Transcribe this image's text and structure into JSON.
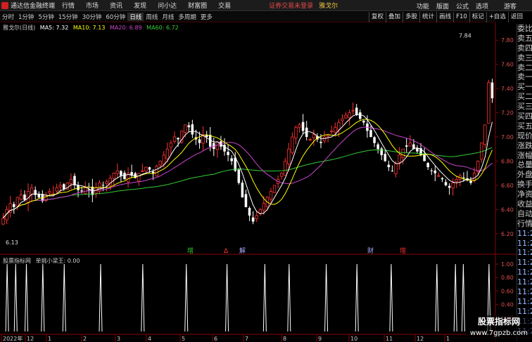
{
  "menubar": {
    "app_title": "通达信金融终端",
    "items": [
      "行情",
      "市场",
      "资讯",
      "发现",
      "问小达",
      "财富圈",
      "交易"
    ],
    "notice": "证券交易未登录",
    "stock": "雅戈尔",
    "right_items": [
      "功能",
      "版面",
      "公式",
      "选项"
    ],
    "guest": "游客"
  },
  "toolbar": {
    "periods": [
      "分时",
      "1分钟",
      "5分钟",
      "15分钟",
      "30分钟",
      "60分钟",
      "日线",
      "周线",
      "月线",
      "多周期",
      "更多"
    ],
    "active_period": "日线",
    "right_tools": [
      "复权",
      "叠加",
      "多股",
      "统计",
      "画线",
      "F10",
      "标记",
      "+自选",
      "返回"
    ]
  },
  "legend": {
    "stock": "雅戈尔(日线)",
    "ma5": "MA5: 7.32",
    "ma10": "MA10: 7.13",
    "ma20": "MA20: 6.89",
    "ma60": "MA60: 6.72"
  },
  "sub_legend": {
    "source": "股票指标网",
    "indicator": "单挑小梁王: 0.00"
  },
  "colors": {
    "up": "#ff3232",
    "down": "#ffffff",
    "ma5": "#ffffff",
    "ma10": "#ffff00",
    "ma20": "#cc44cc",
    "ma60": "#33cc33"
  },
  "price_axis": [
    "7.80",
    "7.60",
    "7.40",
    "7.20",
    "7.00",
    "6.80",
    "6.60",
    "6.40",
    "6.20"
  ],
  "sub_axis": [
    "1.00",
    "0.80",
    "0.60",
    "0.40",
    "0.20"
  ],
  "date_axis": [
    "2022年",
    "12",
    "1",
    "2",
    "3",
    "4",
    "5",
    "6",
    "7",
    "8",
    "9",
    "10",
    "11",
    "12",
    "1"
  ],
  "high_label": "7.84",
  "low_label": "6.13",
  "markers": [
    {
      "text": "增",
      "color": "#33cc33"
    },
    {
      "text": "Δ",
      "color": "#ff3232"
    },
    {
      "text": "解",
      "color": "#aaaaff"
    },
    {
      "text": "财",
      "color": "#aaaaff"
    },
    {
      "text": "增",
      "color": "#ff3232"
    }
  ],
  "right_panel": [
    "委比",
    "卖五",
    "卖四",
    "卖三",
    "卖二",
    "卖一",
    "买一",
    "买二",
    "买三",
    "买四",
    "买五",
    "现价",
    "涨跌",
    "涨幅",
    "总量",
    "外盘",
    "换手",
    "净资",
    "收益",
    "自动",
    "行情",
    "11:29",
    "11:29",
    "11:29",
    "11:29",
    "11:29",
    "11:29",
    "11:29",
    "11:29",
    "11:29",
    "11:29",
    "11:29"
  ],
  "watermark": {
    "title": "股票指标网",
    "url": "www.7gpzb.com"
  },
  "chart_data": {
    "type": "candlestick",
    "ylim": [
      6.1,
      7.9
    ],
    "closes": [
      6.33,
      6.4,
      6.45,
      6.42,
      6.5,
      6.52,
      6.48,
      6.55,
      6.58,
      6.52,
      6.5,
      6.47,
      6.52,
      6.55,
      6.53,
      6.58,
      6.6,
      6.57,
      6.62,
      6.65,
      6.6,
      6.56,
      6.55,
      6.58,
      6.56,
      6.52,
      6.58,
      6.62,
      6.6,
      6.63,
      6.66,
      6.7,
      6.72,
      6.68,
      6.65,
      6.7,
      6.68,
      6.66,
      6.7,
      6.72,
      6.75,
      6.73,
      6.7,
      6.76,
      6.8,
      6.85,
      6.9,
      6.95,
      7.0,
      6.98,
      7.05,
      7.1,
      7.08,
      7.02,
      6.98,
      6.95,
      7.02,
      7.0,
      6.92,
      6.9,
      6.96,
      6.92,
      6.88,
      6.85,
      6.8,
      6.72,
      6.62,
      6.5,
      6.42,
      6.35,
      6.3,
      6.35,
      6.4,
      6.45,
      6.5,
      6.55,
      6.6,
      6.65,
      6.7,
      6.8,
      6.9,
      7.0,
      7.08,
      7.1,
      7.05,
      7.0,
      6.98,
      7.02,
      6.98,
      6.95,
      7.0,
      7.02,
      7.05,
      7.08,
      7.12,
      7.15,
      7.18,
      7.2,
      7.22,
      7.18,
      7.15,
      7.12,
      7.05,
      7.0,
      6.95,
      6.9,
      6.85,
      6.8,
      6.75,
      6.72,
      6.78,
      6.85,
      6.9,
      6.92,
      6.95,
      6.9,
      6.88,
      6.85,
      6.8,
      6.75,
      6.72,
      6.7,
      6.68,
      6.65,
      6.6,
      6.58,
      6.62,
      6.65,
      6.68,
      6.66,
      6.64,
      6.62,
      6.7,
      6.8,
      6.95,
      7.1,
      7.45,
      7.32
    ],
    "ma_lines": [
      "MA5",
      "MA10",
      "MA20",
      "MA60"
    ],
    "sub_indicator_spikes": [
      0.8,
      2.0,
      3.5,
      5.8,
      8.8,
      13.9,
      19.8,
      25.9,
      31.6,
      36.9,
      40.3,
      45.5,
      49.8,
      54.6,
      61.0,
      63.6,
      64.7,
      68.3
    ]
  }
}
